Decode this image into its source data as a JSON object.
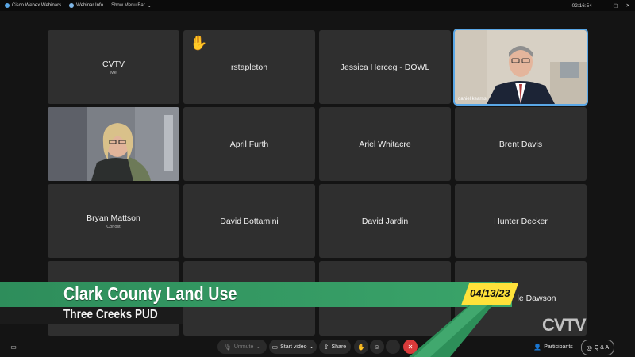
{
  "topbar": {
    "app": "Cisco Webex Webinars",
    "info": "Webinar Info",
    "menu": "Show Menu Bar",
    "time": "02:16:54"
  },
  "tiles": [
    {
      "name": "CVTV",
      "sub": "Me"
    },
    {
      "name": "rstapleton",
      "sub": ""
    },
    {
      "name": "Jessica Herceg - DOWL",
      "sub": ""
    },
    {
      "name": "daniel kearns",
      "sub": ""
    },
    {
      "name": "",
      "sub": ""
    },
    {
      "name": "April Furth",
      "sub": ""
    },
    {
      "name": "Ariel Whitacre",
      "sub": ""
    },
    {
      "name": "Brent Davis",
      "sub": ""
    },
    {
      "name": "Bryan Mattson",
      "sub": "Cohost"
    },
    {
      "name": "David Bottamini",
      "sub": ""
    },
    {
      "name": "David Jardin",
      "sub": ""
    },
    {
      "name": "Hunter Decker",
      "sub": ""
    },
    {
      "name": "",
      "sub": ""
    },
    {
      "name": "",
      "sub": ""
    },
    {
      "name": "",
      "sub": ""
    },
    {
      "name": "le Dawson",
      "sub": ""
    }
  ],
  "lower_third": {
    "title": "Clark County Land Use",
    "subtitle": "Three Creeks PUD",
    "date": "04/13/23"
  },
  "watermark": "CVTV",
  "toolbar": {
    "unmute": "Unmute",
    "start_video": "Start video",
    "share": "Share",
    "participants": "Participants",
    "qa": "Q & A"
  },
  "colors": {
    "accent": "#5aa7e6",
    "green": "#3aa46a",
    "yellow": "#ffe23a",
    "leave": "#d93a3a"
  }
}
